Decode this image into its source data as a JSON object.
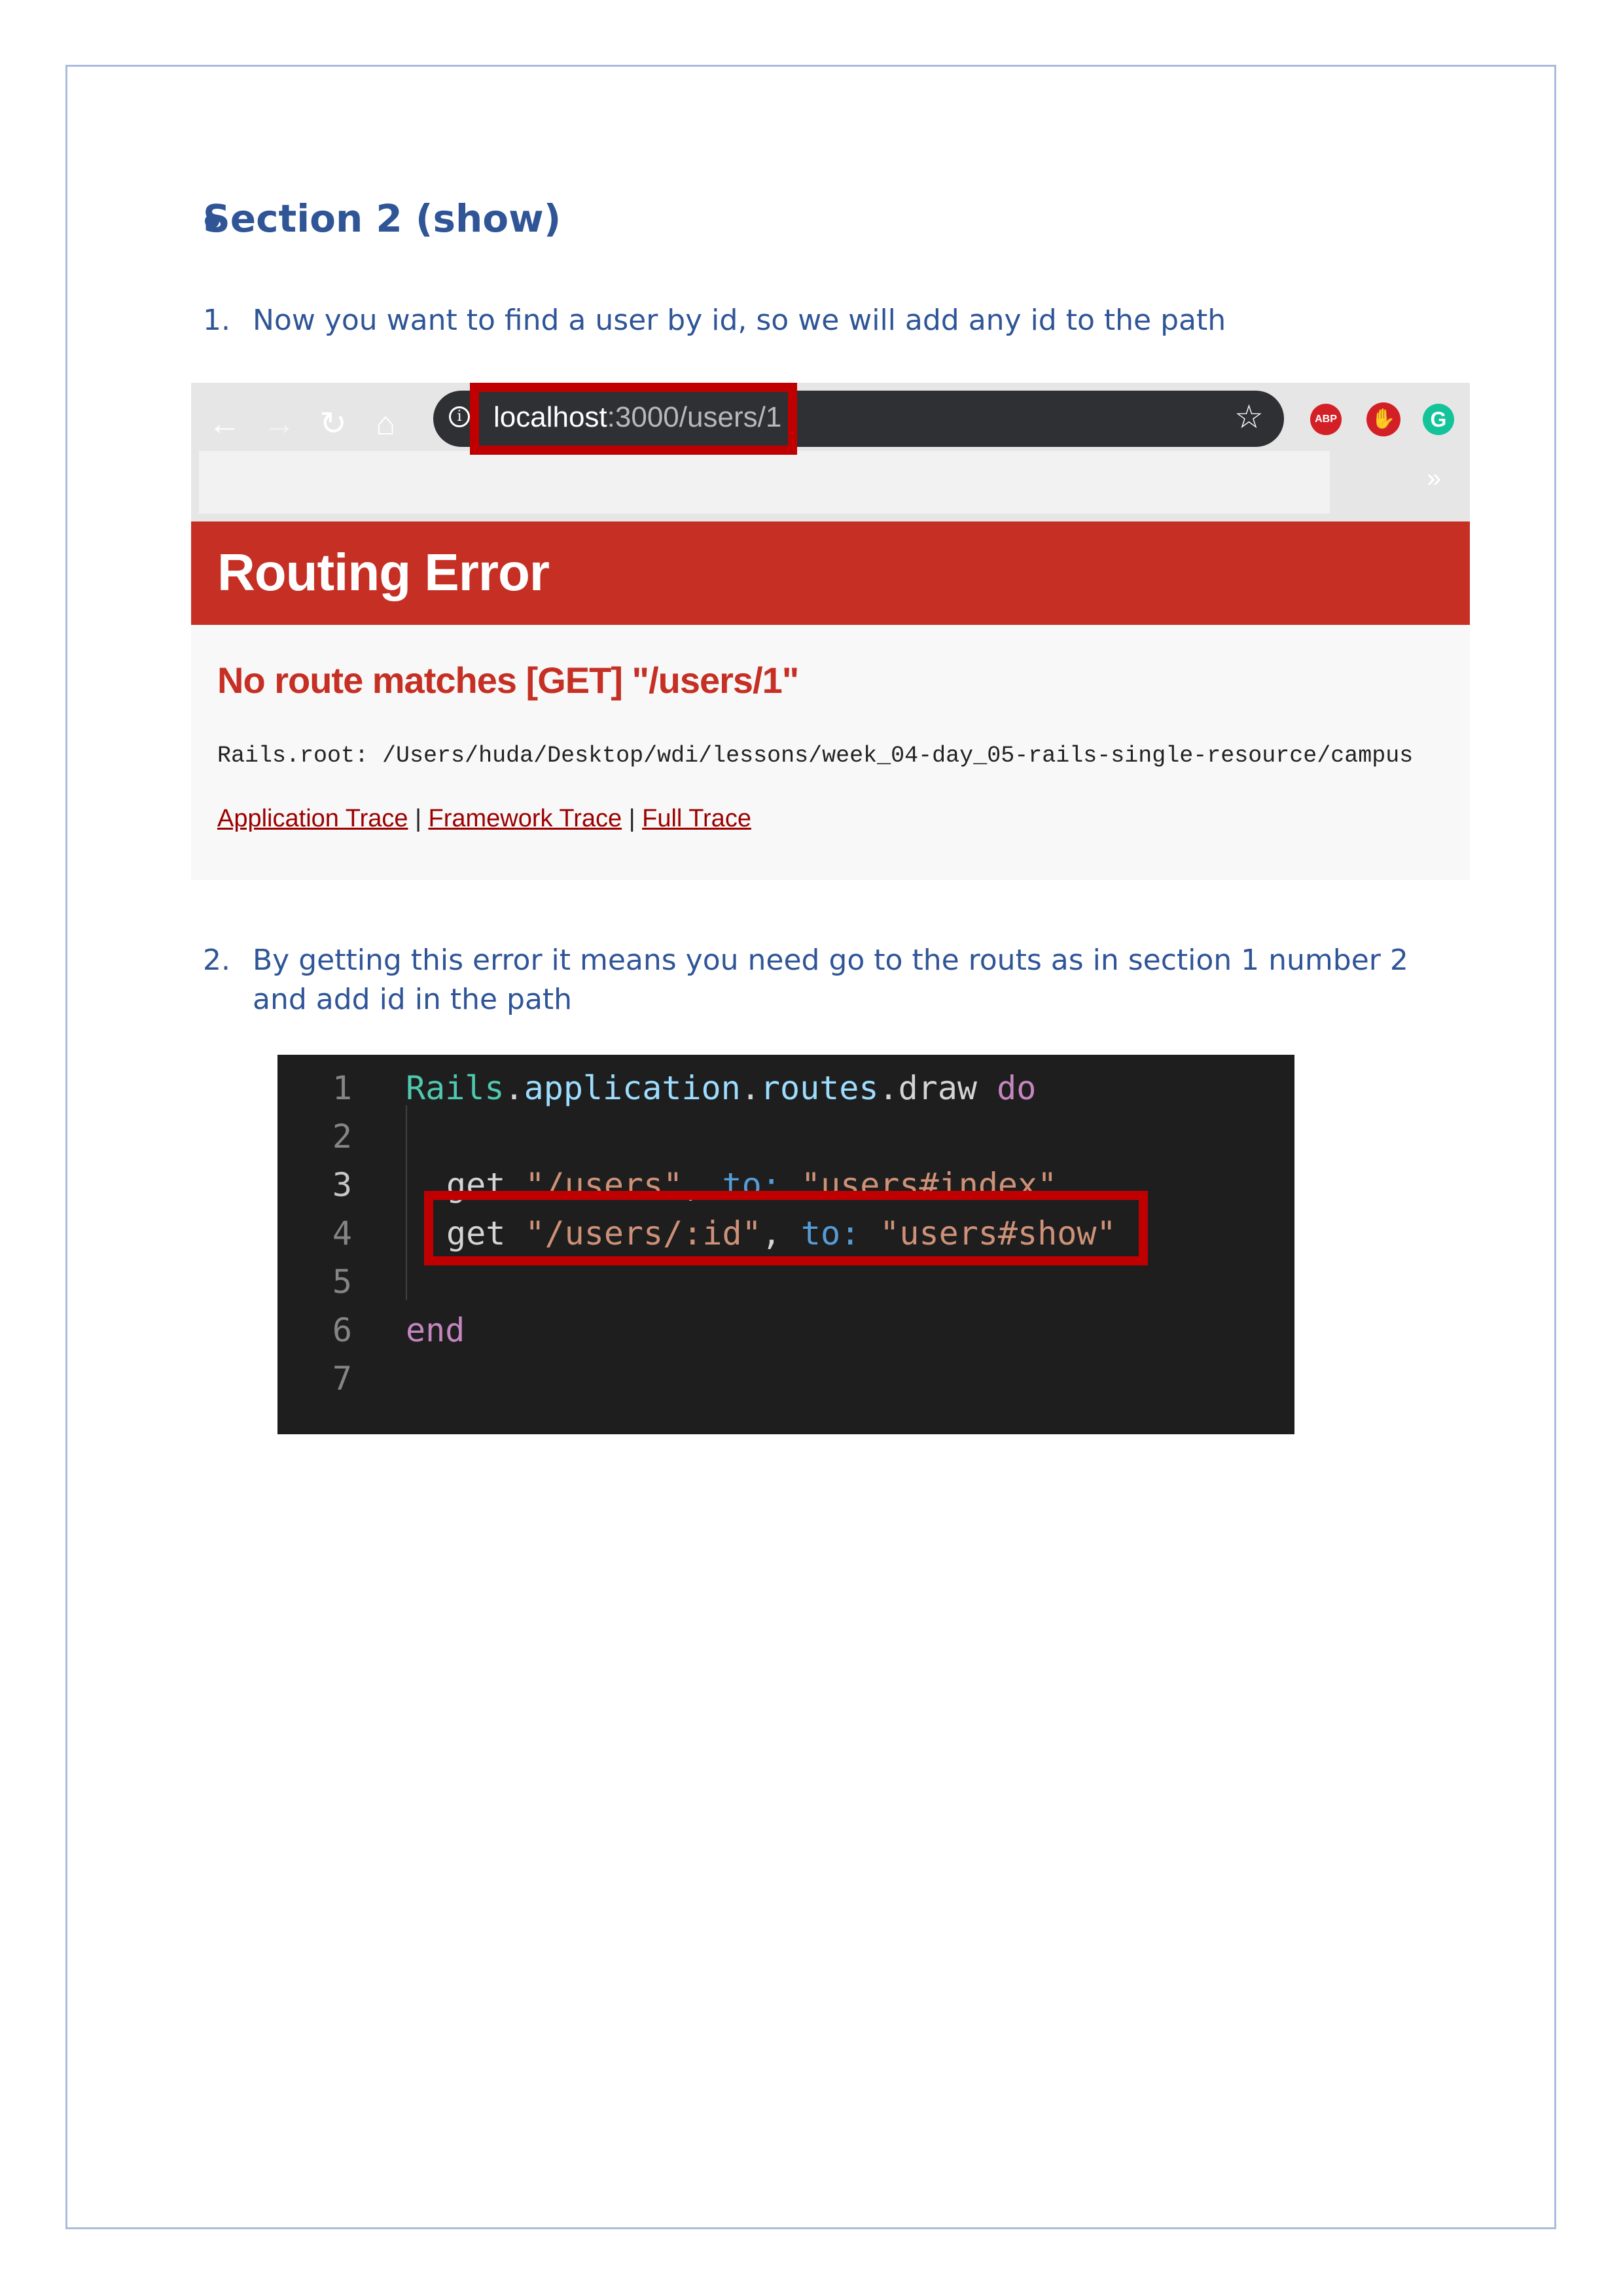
{
  "heading": "Section 2 (show)",
  "steps": [
    {
      "number": "1.",
      "text": "Now you want to find a user by id, so we will add any id to the path"
    },
    {
      "number": "2.",
      "text": "By getting this error it means you need go to the routs as in section 1 number 2 and add id in the path"
    }
  ],
  "browser": {
    "url_host": "localhost",
    "url_path": ":3000/users/1",
    "extensions": [
      "ABP",
      "stop-icon",
      "G"
    ],
    "error_title": "Routing Error",
    "error_message": "No route matches [GET] \"/users/1\"",
    "rails_root": "Rails.root: /Users/huda/Desktop/wdi/lessons/week_04-day_05-rails-single-resource/campus",
    "trace_links": [
      "Application Trace",
      "Framework Trace",
      "Full Trace"
    ],
    "trace_separator": "|",
    "more_label": "»"
  },
  "editor": {
    "line_numbers": [
      "1",
      "2",
      "3",
      "4",
      "5",
      "6",
      "7"
    ],
    "line1": {
      "const": "Rails",
      "dot1": ".",
      "app": "application",
      "dot2": ".",
      "routes": "routes",
      "dot3": ".",
      "draw": "draw ",
      "do": "do"
    },
    "line3": {
      "get": "get ",
      "path": "\"/users\"",
      "comma": ", ",
      "to": "to:",
      "space": " ",
      "action": "\"users#index\""
    },
    "line4": {
      "get": "get ",
      "path": "\"/users/:id\"",
      "comma": ", ",
      "to": "to:",
      "space": " ",
      "action": "\"users#show\""
    },
    "line6": {
      "end": "end"
    }
  },
  "colors": {
    "highlight": "#c00000",
    "error_red": "#c52f24",
    "doc_blue": "#2f5597"
  }
}
